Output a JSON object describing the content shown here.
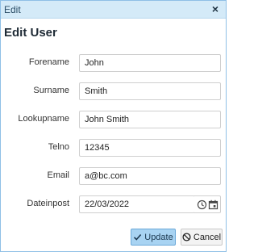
{
  "window": {
    "title": "Edit",
    "close_label": "×"
  },
  "form": {
    "heading": "Edit User",
    "fields": [
      {
        "label": "Forename",
        "value": "John"
      },
      {
        "label": "Surname",
        "value": "Smith"
      },
      {
        "label": "Lookupname",
        "value": "John Smith"
      },
      {
        "label": "Telno",
        "value": "12345"
      },
      {
        "label": "Email",
        "value": "a@bc.com"
      },
      {
        "label": "Dateinpost",
        "value": "22/03/2022"
      }
    ]
  },
  "buttons": {
    "update_label": "Update",
    "cancel_label": "Cancel"
  },
  "icons": {
    "update": "check-icon",
    "cancel": "cancel-circle-icon",
    "time": "clock-icon",
    "date": "calendar-icon"
  },
  "colors": {
    "titlebar": "#d4eaf8",
    "update_button": "#a8d3f2",
    "border_accent": "#8fbfe6"
  }
}
